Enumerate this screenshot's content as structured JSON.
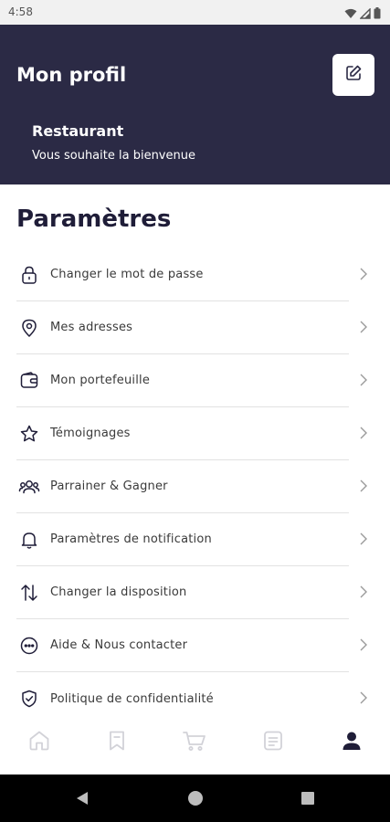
{
  "status_bar": {
    "time": "4:58",
    "icons": [
      "wifi-icon",
      "signal-icon",
      "battery-icon"
    ]
  },
  "header": {
    "title": "Mon profil",
    "edit_icon": "edit-icon",
    "restaurant_name": "Restaurant",
    "welcome": "Vous souhaite la bienvenue",
    "background_color": "#2b2a45"
  },
  "settings": {
    "title": "Paramètres",
    "items": [
      {
        "label": "Changer le mot de passe",
        "icon": "lock-icon"
      },
      {
        "label": "Mes adresses",
        "icon": "location-pin-icon"
      },
      {
        "label": "Mon portefeuille",
        "icon": "wallet-icon"
      },
      {
        "label": "Témoignages",
        "icon": "star-icon"
      },
      {
        "label": "Parrainer & Gagner",
        "icon": "users-icon"
      },
      {
        "label": "Paramètres de notification",
        "icon": "bell-icon"
      },
      {
        "label": "Changer la disposition",
        "icon": "swap-arrows-icon"
      },
      {
        "label": "Aide & Nous contacter",
        "icon": "chat-dots-icon"
      },
      {
        "label": "Politique de confidentialité",
        "icon": "shield-check-icon"
      }
    ]
  },
  "bottom_nav": {
    "items": [
      {
        "icon": "home-icon",
        "active": false
      },
      {
        "icon": "bookmark-icon",
        "active": false
      },
      {
        "icon": "cart-icon",
        "active": false
      },
      {
        "icon": "orders-icon",
        "active": false
      },
      {
        "icon": "profile-icon",
        "active": true
      }
    ]
  },
  "system_nav": {
    "buttons": [
      "back-icon",
      "home-circle-icon",
      "recents-icon"
    ]
  }
}
